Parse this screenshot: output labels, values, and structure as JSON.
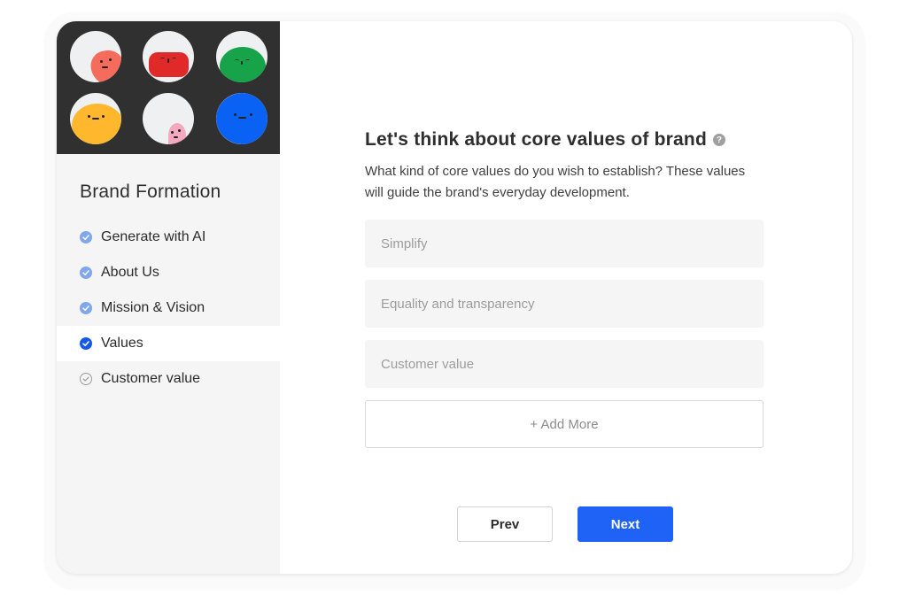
{
  "sidebar": {
    "title": "Brand Formation",
    "steps": [
      {
        "label": "Generate with AI",
        "status": "done"
      },
      {
        "label": "About Us",
        "status": "done"
      },
      {
        "label": "Mission & Vision",
        "status": "done"
      },
      {
        "label": "Values",
        "status": "current"
      },
      {
        "label": "Customer value",
        "status": "todo"
      }
    ]
  },
  "illustration": {
    "icon": "avatar-faces-icon",
    "colors": {
      "background": "#303030",
      "face": "#eef0f2",
      "coral": "#f56b5c",
      "red": "#e02a2a",
      "green": "#17a34a",
      "yellow": "#ffb82e",
      "pink": "#f4a9bd",
      "blue": "#0a62f5"
    }
  },
  "main": {
    "heading": "Let's think about core values of brand",
    "help_icon": "help-circle-icon",
    "description": "What kind of core values do you wish to establish? These values will guide the brand's everyday development.",
    "fields": [
      {
        "placeholder": "Simplify",
        "value": ""
      },
      {
        "placeholder": "Equality and transparency",
        "value": ""
      },
      {
        "placeholder": "Customer value",
        "value": ""
      }
    ],
    "add_more_label": "+ Add More",
    "prev_label": "Prev",
    "next_label": "Next"
  },
  "colors": {
    "accent": "#1e63f5",
    "done_check": "#7fa6ee",
    "current_check": "#1659e8"
  }
}
